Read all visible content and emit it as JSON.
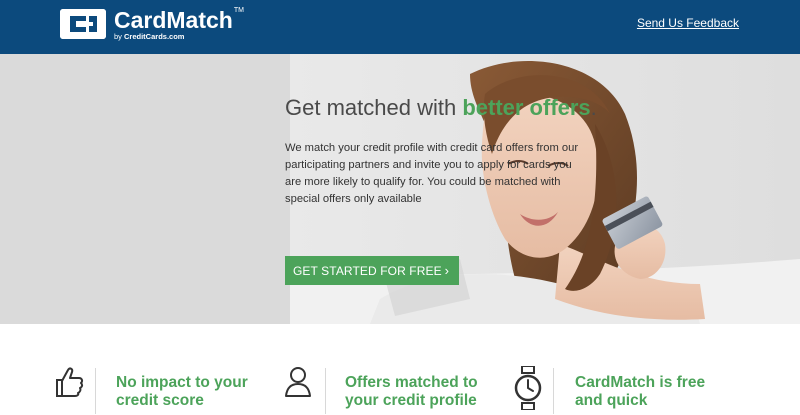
{
  "header": {
    "brand": "CardMatch",
    "trademark": "TM",
    "byline_prefix": "by",
    "byline_brand": "CreditCards.com",
    "feedback_link": "Send Us Feedback"
  },
  "hero": {
    "title_plain": "Get matched with ",
    "title_highlight": "better offers",
    "title_end": ".",
    "body": "We match your credit profile with credit card offers from our participating partners and invite you to apply for cards you are more likely to qualify for. You could be matched with special offers only available",
    "cta_label": "GET STARTED FOR FREE",
    "cta_chevron": "›"
  },
  "features": [
    {
      "icon": "thumbs-up-icon",
      "line1": "No impact to your",
      "line2": "credit score"
    },
    {
      "icon": "person-icon",
      "line1": "Offers matched to",
      "line2": "your credit profile"
    },
    {
      "icon": "stopwatch-icon",
      "line1": "CardMatch is free",
      "line2": "and quick"
    }
  ],
  "colors": {
    "header_bg": "#0c4a7d",
    "accent_green": "#4ca35a"
  }
}
